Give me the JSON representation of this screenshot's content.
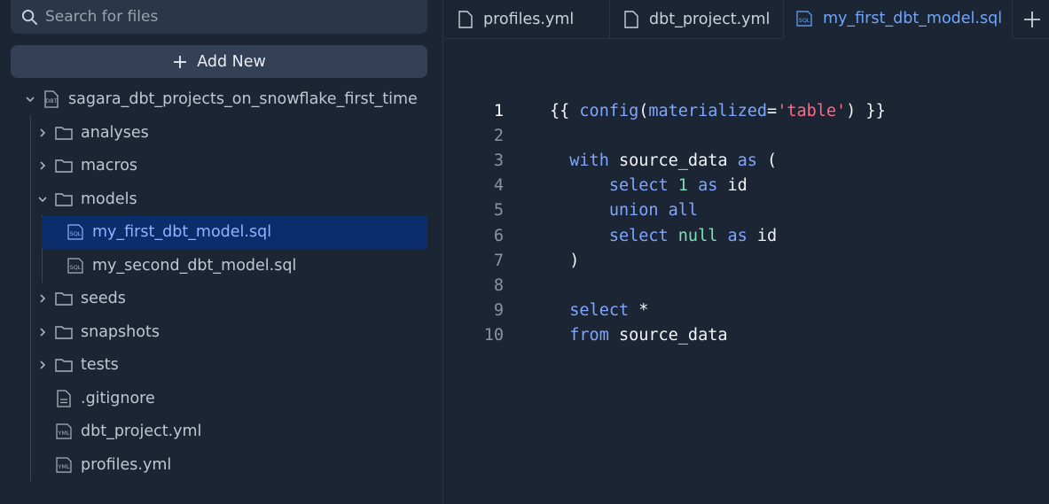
{
  "search": {
    "placeholder": "Search for files"
  },
  "add_new": {
    "label": "Add New"
  },
  "tree": {
    "root": {
      "label": "sagara_dbt_projects_on_snowflake_first_time",
      "badge": "DBT"
    },
    "items": [
      {
        "label": "analyses",
        "type": "folder",
        "expanded": false
      },
      {
        "label": "macros",
        "type": "folder",
        "expanded": false
      },
      {
        "label": "models",
        "type": "folder",
        "expanded": true
      },
      {
        "label": "my_first_dbt_model.sql",
        "type": "sql",
        "selected": true
      },
      {
        "label": "my_second_dbt_model.sql",
        "type": "sql"
      },
      {
        "label": "seeds",
        "type": "folder",
        "expanded": false
      },
      {
        "label": "snapshots",
        "type": "folder",
        "expanded": false
      },
      {
        "label": "tests",
        "type": "folder",
        "expanded": false
      },
      {
        "label": ".gitignore",
        "type": "file"
      },
      {
        "label": "dbt_project.yml",
        "type": "yml"
      },
      {
        "label": "profiles.yml",
        "type": "yml"
      }
    ],
    "badges": {
      "sql": "SQL",
      "yml": "YML"
    }
  },
  "tabs": [
    {
      "label": "profiles.yml",
      "icon": "file-icon"
    },
    {
      "label": "dbt_project.yml",
      "icon": "file-icon"
    },
    {
      "label": "my_first_dbt_model.sql",
      "icon": "sql-file-icon",
      "active": true
    }
  ],
  "editor": {
    "line_numbers": [
      "1",
      "2",
      "3",
      "4",
      "5",
      "6",
      "7",
      "8",
      "9",
      "10"
    ],
    "lines": [
      [
        [
          "punc",
          "{{ "
        ],
        [
          "fn",
          "config"
        ],
        [
          "punc",
          "("
        ],
        [
          "kw",
          "materialized"
        ],
        [
          "punc",
          "="
        ],
        [
          "str",
          "'table'"
        ],
        [
          "punc",
          ") }}"
        ]
      ],
      [],
      [
        [
          "kw",
          "  with"
        ],
        [
          "punc",
          " source_data "
        ],
        [
          "kw",
          "as"
        ],
        [
          "punc",
          " ("
        ]
      ],
      [
        [
          "kw",
          "      select"
        ],
        [
          "punc",
          " "
        ],
        [
          "num",
          "1"
        ],
        [
          "punc",
          " "
        ],
        [
          "kw",
          "as"
        ],
        [
          "punc",
          " id"
        ]
      ],
      [
        [
          "kw",
          "      union all"
        ]
      ],
      [
        [
          "kw",
          "      select"
        ],
        [
          "punc",
          " "
        ],
        [
          "num",
          "null"
        ],
        [
          "punc",
          " "
        ],
        [
          "kw",
          "as"
        ],
        [
          "punc",
          " id"
        ]
      ],
      [
        [
          "punc",
          "  )"
        ]
      ],
      [],
      [
        [
          "kw",
          "  select"
        ],
        [
          "punc",
          " *"
        ]
      ],
      [
        [
          "kw",
          "  from"
        ],
        [
          "punc",
          " source_data"
        ]
      ]
    ]
  },
  "colors": {
    "background": "#1b2533",
    "selection": "#0b2d6b",
    "accent": "#6ea6ff"
  }
}
